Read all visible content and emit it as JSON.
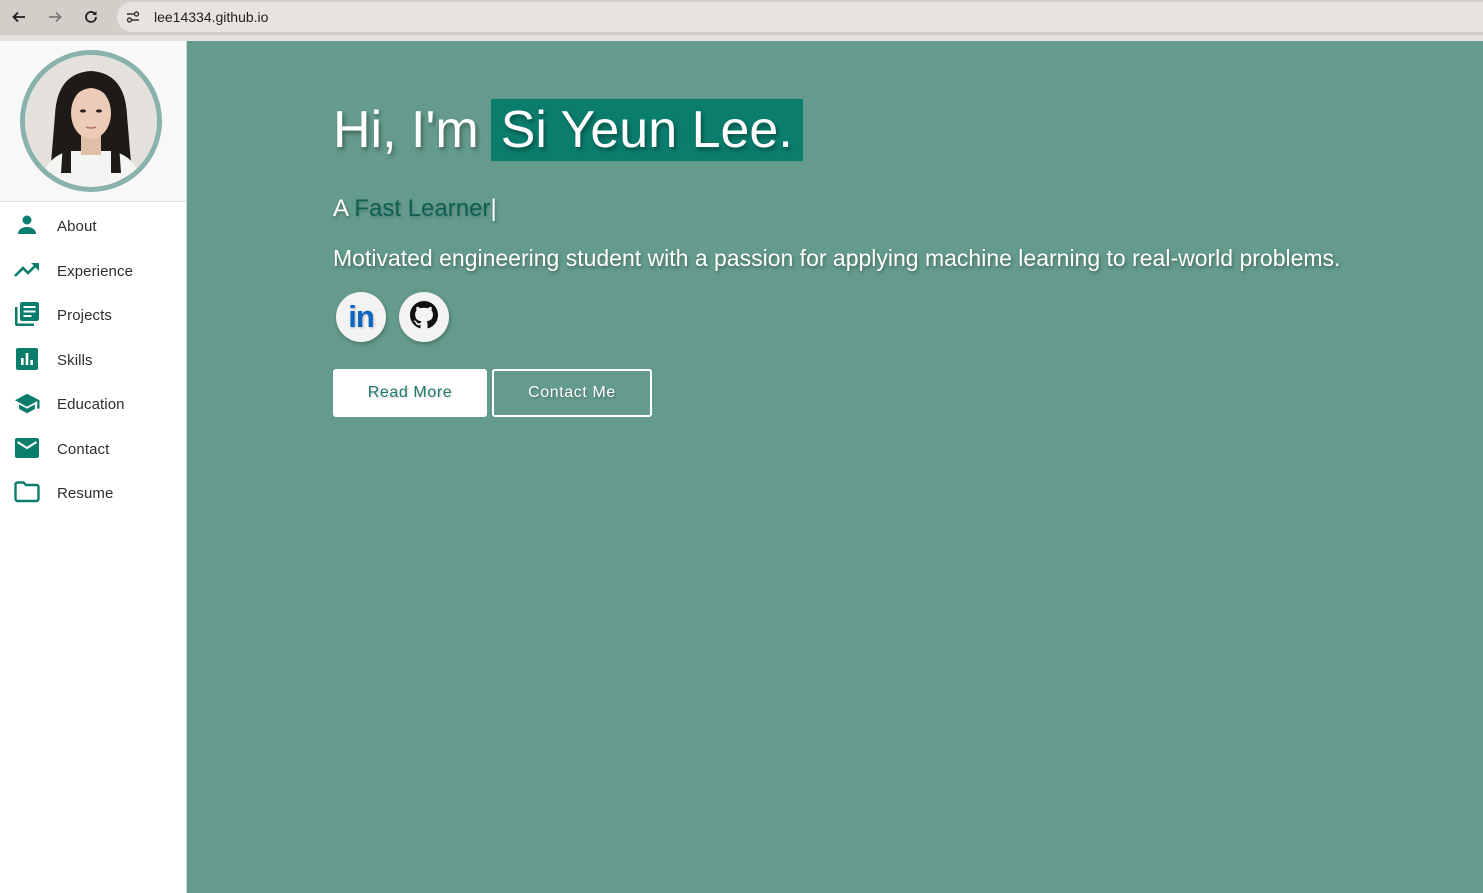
{
  "browser": {
    "url": "lee14334.github.io",
    "icons": [
      "back-arrow-icon",
      "forward-arrow-icon",
      "reload-icon",
      "site-info-icon"
    ]
  },
  "sidebar": {
    "avatar_alt": "profile-photo",
    "items": [
      {
        "label": "About",
        "icon": "person-icon"
      },
      {
        "label": "Experience",
        "icon": "trending-up-icon"
      },
      {
        "label": "Projects",
        "icon": "library-books-icon"
      },
      {
        "label": "Skills",
        "icon": "bar-chart-icon"
      },
      {
        "label": "Education",
        "icon": "school-icon"
      },
      {
        "label": "Contact",
        "icon": "mail-icon"
      },
      {
        "label": "Resume",
        "icon": "folder-icon"
      }
    ],
    "accent": "#0b7d6d"
  },
  "hero": {
    "greeting": "Hi, I'm",
    "name": "Si Yeun Lee.",
    "tagline_prefix": "A",
    "tagline_typed": "Fast Learner",
    "tagline_cursor": "|",
    "description": "Motivated engineering student with a passion for applying machine learning to real-world problems.",
    "social": [
      {
        "name": "LinkedIn",
        "icon": "linkedin-icon",
        "text": "in"
      },
      {
        "name": "GitHub",
        "icon": "github-icon"
      }
    ],
    "read_more_label": "Read More",
    "contact_label": "Contact Me",
    "background": "#649b8c"
  }
}
